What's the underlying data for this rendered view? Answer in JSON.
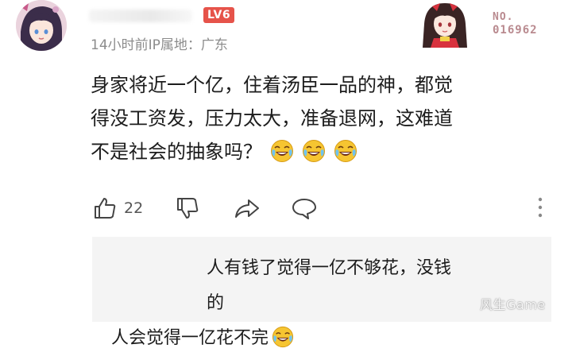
{
  "header": {
    "level_badge": "LV6",
    "meta": "14小时前IP属地：广东",
    "deco_label_no": "NO.",
    "deco_label_number": "016962"
  },
  "comment": {
    "lines": [
      "身家将近一个亿，住着汤臣一品的神，都觉",
      "得没工资发，压力太大，准备退网，这难道",
      "不是社会的抽象吗？"
    ],
    "emoji": "laughing-crying-emoji"
  },
  "actions": {
    "like_count": "22"
  },
  "reply": {
    "line1": "人有钱了觉得一亿不够花，没钱的",
    "line2": "人会觉得一亿花不完"
  },
  "watermark": "风生Game",
  "colors": {
    "level_badge": "#e6534a",
    "meta_text": "#8c8c8c",
    "reply_bg": "#f4f4f4",
    "emoji_face": "#f6c531"
  }
}
